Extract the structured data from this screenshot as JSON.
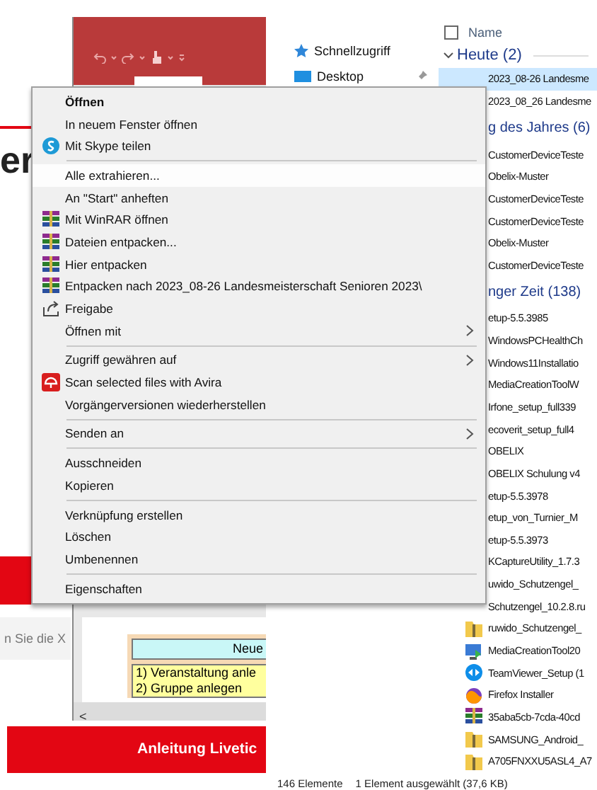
{
  "browser_page": {
    "heading": "er",
    "field_text": "n Sie die X",
    "banner": "Anleitung Livetic"
  },
  "word_window": {
    "table": {
      "header": "Neue",
      "rows": [
        "1) Veranstaltung anle",
        "2) Gruppe anlegen"
      ]
    },
    "scroll_left": "<"
  },
  "explorer": {
    "nav": [
      {
        "label": "Schnellzugriff",
        "kind": "star"
      },
      {
        "label": "Desktop",
        "kind": "desktop"
      }
    ],
    "column": {
      "label": "Name",
      "checked": false
    },
    "list": [
      {
        "kind": "group",
        "label": "Heute (2)"
      },
      {
        "kind": "file",
        "label": "2023_08-26 Landesme",
        "selected": true
      },
      {
        "kind": "file",
        "label": "2023_08_26 Landesme",
        "selected": false
      },
      {
        "kind": "group_cut",
        "label": "g des Jahres (6)"
      },
      {
        "kind": "file",
        "label": "CustomerDeviceTeste",
        "selected": false
      },
      {
        "kind": "file",
        "label": "Obelix-Muster",
        "selected": false
      },
      {
        "kind": "file",
        "label": "CustomerDeviceTeste",
        "selected": false
      },
      {
        "kind": "file",
        "label": "CustomerDeviceTeste",
        "selected": false
      },
      {
        "kind": "file",
        "label": "Obelix-Muster",
        "selected": false
      },
      {
        "kind": "file",
        "label": "CustomerDeviceTeste",
        "selected": false
      },
      {
        "kind": "group_cut",
        "label": "nger Zeit (138)"
      },
      {
        "kind": "file",
        "label": "etup-5.5.3985",
        "selected": false
      },
      {
        "kind": "file",
        "label": "WindowsPCHealthCh",
        "selected": false
      },
      {
        "kind": "file",
        "label": "Windows11Installatio",
        "selected": false
      },
      {
        "kind": "file",
        "label": "MediaCreationToolW",
        "selected": false
      },
      {
        "kind": "file",
        "label": "Irfone_setup_full339",
        "selected": false
      },
      {
        "kind": "file",
        "label": "ecoverit_setup_full4",
        "selected": false
      },
      {
        "kind": "file",
        "label": "OBELIX",
        "selected": false
      },
      {
        "kind": "file",
        "label": "OBELIX Schulung v4",
        "selected": false
      },
      {
        "kind": "file",
        "label": "etup-5.5.3978",
        "selected": false
      },
      {
        "kind": "file",
        "label": "etup_von_Turnier_M",
        "selected": false
      },
      {
        "kind": "file",
        "label": "etup-5.5.3973",
        "selected": false
      },
      {
        "kind": "file",
        "label": "KCaptureUtility_1.7.3",
        "selected": false
      },
      {
        "kind": "file",
        "label": "uwido_Schutzengel_",
        "selected": false
      },
      {
        "kind": "file",
        "label": "Schutzengel_10.2.8.ru",
        "selected": false
      },
      {
        "kind": "zip",
        "label": "ruwido_Schutzengel_",
        "selected": false
      },
      {
        "kind": "setup",
        "label": "MediaCreationTool20",
        "selected": false
      },
      {
        "kind": "remote",
        "label": "TeamViewer_Setup (1",
        "selected": false
      },
      {
        "kind": "browser",
        "label": "Firefox Installer",
        "selected": false
      },
      {
        "kind": "archive",
        "label": "35aba5cb-7cda-40cd",
        "selected": false
      },
      {
        "kind": "zip",
        "label": "SAMSUNG_Android_",
        "selected": false
      },
      {
        "kind": "zip",
        "label": "A705FNXXU5ASL4_A7",
        "selected": false
      }
    ],
    "status": {
      "count": "146 Elemente",
      "selection": "1 Element ausgewählt (37,6 KB)"
    }
  },
  "context_menu": {
    "items": [
      {
        "kind": "item",
        "label": "Öffnen",
        "default": true,
        "selected": false,
        "submenu": false
      },
      {
        "kind": "item",
        "label": "In neuem Fenster öffnen",
        "default": false,
        "selected": false,
        "submenu": false
      },
      {
        "kind": "skype",
        "label": "Mit Skype teilen",
        "default": false,
        "selected": false,
        "submenu": false
      },
      {
        "kind": "separator"
      },
      {
        "kind": "item",
        "label": "Alle extrahieren...",
        "default": false,
        "selected": true,
        "submenu": false
      },
      {
        "kind": "item",
        "label": "An \"Start\" anheften",
        "default": false,
        "selected": false,
        "submenu": false
      },
      {
        "kind": "archive",
        "label": "Mit WinRAR öffnen",
        "default": false,
        "selected": false,
        "submenu": false
      },
      {
        "kind": "archive",
        "label": "Dateien entpacken...",
        "default": false,
        "selected": false,
        "submenu": false
      },
      {
        "kind": "archive",
        "label": "Hier entpacken",
        "default": false,
        "selected": false,
        "submenu": false
      },
      {
        "kind": "archive",
        "label": "Entpacken nach 2023_08-26 Landesmeisterschaft Senioren 2023\\",
        "default": false,
        "selected": false,
        "submenu": false
      },
      {
        "kind": "share",
        "label": "Freigabe",
        "default": false,
        "selected": false,
        "submenu": false
      },
      {
        "kind": "item",
        "label": "Öffnen mit",
        "default": false,
        "selected": false,
        "submenu": true
      },
      {
        "kind": "separator"
      },
      {
        "kind": "item",
        "label": "Zugriff gewähren auf",
        "default": false,
        "selected": false,
        "submenu": true
      },
      {
        "kind": "scan",
        "label": "Scan selected files with Avira",
        "default": false,
        "selected": false,
        "submenu": false
      },
      {
        "kind": "item",
        "label": "Vorgängerversionen wiederherstellen",
        "default": false,
        "selected": false,
        "submenu": false
      },
      {
        "kind": "separator"
      },
      {
        "kind": "item",
        "label": "Senden an",
        "default": false,
        "selected": false,
        "submenu": true
      },
      {
        "kind": "separator"
      },
      {
        "kind": "item",
        "label": "Ausschneiden",
        "default": false,
        "selected": false,
        "submenu": false
      },
      {
        "kind": "item",
        "label": "Kopieren",
        "default": false,
        "selected": false,
        "submenu": false
      },
      {
        "kind": "separator"
      },
      {
        "kind": "item",
        "label": "Verknüpfung erstellen",
        "default": false,
        "selected": false,
        "submenu": false
      },
      {
        "kind": "item",
        "label": "Löschen",
        "default": false,
        "selected": false,
        "submenu": false
      },
      {
        "kind": "item",
        "label": "Umbenennen",
        "default": false,
        "selected": false,
        "submenu": false
      },
      {
        "kind": "separator"
      },
      {
        "kind": "item",
        "label": "Eigenschaften",
        "default": false,
        "selected": false,
        "submenu": false
      }
    ]
  }
}
